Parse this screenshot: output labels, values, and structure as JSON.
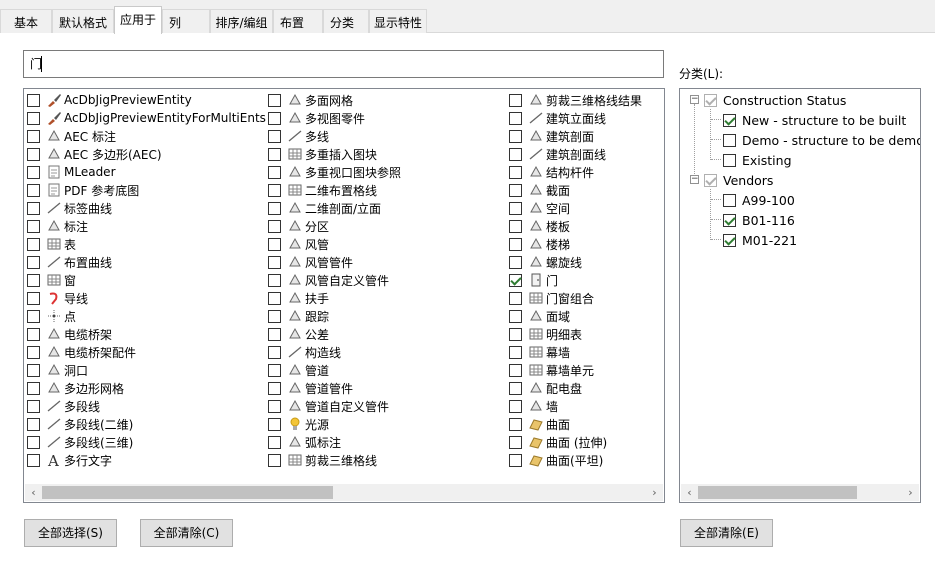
{
  "tabs": [
    {
      "label": "基本",
      "active": false
    },
    {
      "label": "默认格式",
      "active": false
    },
    {
      "label": "应用于",
      "active": true
    },
    {
      "label": "列",
      "active": false
    },
    {
      "label": "排序/编组",
      "active": false
    },
    {
      "label": "布置",
      "active": false
    },
    {
      "label": "分类",
      "active": false
    },
    {
      "label": "显示特性",
      "active": false
    }
  ],
  "search": {
    "value": "门"
  },
  "columns": [
    [
      {
        "label": "AcDbJigPreviewEntity",
        "checked": false,
        "icon": "brush-icon"
      },
      {
        "label": "AcDbJigPreviewEntityForMultiEnts",
        "checked": false,
        "icon": "brush-icon"
      },
      {
        "label": "AEC 标注",
        "checked": false,
        "icon": "dimension-icon"
      },
      {
        "label": "AEC 多边形(AEC)",
        "checked": false,
        "icon": "polygon-icon"
      },
      {
        "label": "MLeader",
        "checked": false,
        "icon": "mleader-icon"
      },
      {
        "label": "PDF 参考底图",
        "checked": false,
        "icon": "pdf-icon"
      },
      {
        "label": "标签曲线",
        "checked": false,
        "icon": "label-curve-icon"
      },
      {
        "label": "标注",
        "checked": false,
        "icon": "annotation-icon"
      },
      {
        "label": "表",
        "checked": false,
        "icon": "table-icon"
      },
      {
        "label": "布置曲线",
        "checked": false,
        "icon": "layout-curve-icon"
      },
      {
        "label": "窗",
        "checked": false,
        "icon": "window-icon"
      },
      {
        "label": "导线",
        "checked": false,
        "icon": "leader-icon"
      },
      {
        "label": "点",
        "checked": false,
        "icon": "point-icon"
      },
      {
        "label": "电缆桥架",
        "checked": false,
        "icon": "cable-tray-icon"
      },
      {
        "label": "电缆桥架配件",
        "checked": false,
        "icon": "cable-fitting-icon"
      },
      {
        "label": "洞口",
        "checked": false,
        "icon": "opening-icon"
      },
      {
        "label": "多边形网格",
        "checked": false,
        "icon": "polygon-mesh-icon"
      },
      {
        "label": "多段线",
        "checked": false,
        "icon": "polyline-icon"
      },
      {
        "label": "多段线(二维)",
        "checked": false,
        "icon": "polyline-2d-icon"
      },
      {
        "label": "多段线(三维)",
        "checked": false,
        "icon": "polyline-3d-icon"
      },
      {
        "label": "多行文字",
        "checked": false,
        "icon": "mtext-icon"
      }
    ],
    [
      {
        "label": "多面网格",
        "checked": false,
        "icon": "polyface-mesh-icon"
      },
      {
        "label": "多视图零件",
        "checked": false,
        "icon": "multiview-part-icon"
      },
      {
        "label": "多线",
        "checked": false,
        "icon": "mline-icon"
      },
      {
        "label": "多重插入图块",
        "checked": false,
        "icon": "minsert-icon"
      },
      {
        "label": "多重视口图块参照",
        "checked": false,
        "icon": "multi-viewport-block-icon"
      },
      {
        "label": "二维布置格线",
        "checked": false,
        "icon": "grid-2d-icon"
      },
      {
        "label": "二维剖面/立面",
        "checked": false,
        "icon": "section-elevation-icon"
      },
      {
        "label": "分区",
        "checked": false,
        "icon": "zone-icon"
      },
      {
        "label": "风管",
        "checked": false,
        "icon": "duct-icon"
      },
      {
        "label": "风管管件",
        "checked": false,
        "icon": "duct-fitting-icon"
      },
      {
        "label": "风管自定义管件",
        "checked": false,
        "icon": "duct-custom-icon"
      },
      {
        "label": "扶手",
        "checked": false,
        "icon": "railing-icon"
      },
      {
        "label": "跟踪",
        "checked": false,
        "icon": "trace-icon"
      },
      {
        "label": "公差",
        "checked": false,
        "icon": "tolerance-icon"
      },
      {
        "label": "构造线",
        "checked": false,
        "icon": "xline-icon"
      },
      {
        "label": "管道",
        "checked": false,
        "icon": "pipe-icon"
      },
      {
        "label": "管道管件",
        "checked": false,
        "icon": "pipe-fitting-icon"
      },
      {
        "label": "管道自定义管件",
        "checked": false,
        "icon": "pipe-custom-icon"
      },
      {
        "label": "光源",
        "checked": false,
        "icon": "light-icon"
      },
      {
        "label": "弧标注",
        "checked": false,
        "icon": "arc-dimension-icon"
      },
      {
        "label": "剪裁三维格线",
        "checked": false,
        "icon": "clip-3d-grid-icon"
      }
    ],
    [
      {
        "label": "剪裁三维格线结果",
        "checked": false,
        "icon": "clip-result-icon"
      },
      {
        "label": "建筑立面线",
        "checked": false,
        "icon": "elevation-line-icon"
      },
      {
        "label": "建筑剖面",
        "checked": false,
        "icon": "building-section-icon"
      },
      {
        "label": "建筑剖面线",
        "checked": false,
        "icon": "section-line-icon"
      },
      {
        "label": "结构杆件",
        "checked": false,
        "icon": "structural-member-icon"
      },
      {
        "label": "截面",
        "checked": false,
        "icon": "cross-section-icon"
      },
      {
        "label": "空间",
        "checked": false,
        "icon": "space-icon"
      },
      {
        "label": "楼板",
        "checked": false,
        "icon": "slab-icon"
      },
      {
        "label": "楼梯",
        "checked": false,
        "icon": "stair-icon"
      },
      {
        "label": "螺旋线",
        "checked": false,
        "icon": "helix-icon"
      },
      {
        "label": "门",
        "checked": true,
        "icon": "door-icon"
      },
      {
        "label": "门窗组合",
        "checked": false,
        "icon": "door-window-assembly-icon"
      },
      {
        "label": "面域",
        "checked": false,
        "icon": "region-icon"
      },
      {
        "label": "明细表",
        "checked": false,
        "icon": "schedule-table-icon"
      },
      {
        "label": "幕墙",
        "checked": false,
        "icon": "curtain-wall-icon"
      },
      {
        "label": "幕墙单元",
        "checked": false,
        "icon": "curtain-wall-unit-icon"
      },
      {
        "label": "配电盘",
        "checked": false,
        "icon": "panel-icon"
      },
      {
        "label": "墙",
        "checked": false,
        "icon": "wall-icon"
      },
      {
        "label": "曲面",
        "checked": false,
        "icon": "surface-icon"
      },
      {
        "label": "曲面 (拉伸)",
        "checked": false,
        "icon": "extruded-surface-icon"
      },
      {
        "label": "曲面(平坦)",
        "checked": false,
        "icon": "planar-surface-icon"
      }
    ]
  ],
  "buttons": {
    "select_all": "全部选择(S)",
    "clear_all": "全部清除(C)",
    "clear_all_category": "全部清除(E)"
  },
  "category": {
    "label": "分类(L):",
    "tree": [
      {
        "label": "Construction Status",
        "checked": true,
        "gray": true,
        "children": [
          {
            "label": "New - structure to be built",
            "checked": true
          },
          {
            "label": "Demo - structure to be demol",
            "checked": false
          },
          {
            "label": "Existing",
            "checked": false
          }
        ]
      },
      {
        "label": "Vendors",
        "checked": true,
        "gray": true,
        "children": [
          {
            "label": "A99-100",
            "checked": false
          },
          {
            "label": "B01-116",
            "checked": true
          },
          {
            "label": "M01-221",
            "checked": true
          }
        ]
      }
    ]
  },
  "colors": {
    "accent_check": "#2f7d32",
    "panel_bg": "#ffffff",
    "window_bg": "#f0f0f0",
    "button_bg": "#e1e1e1"
  }
}
